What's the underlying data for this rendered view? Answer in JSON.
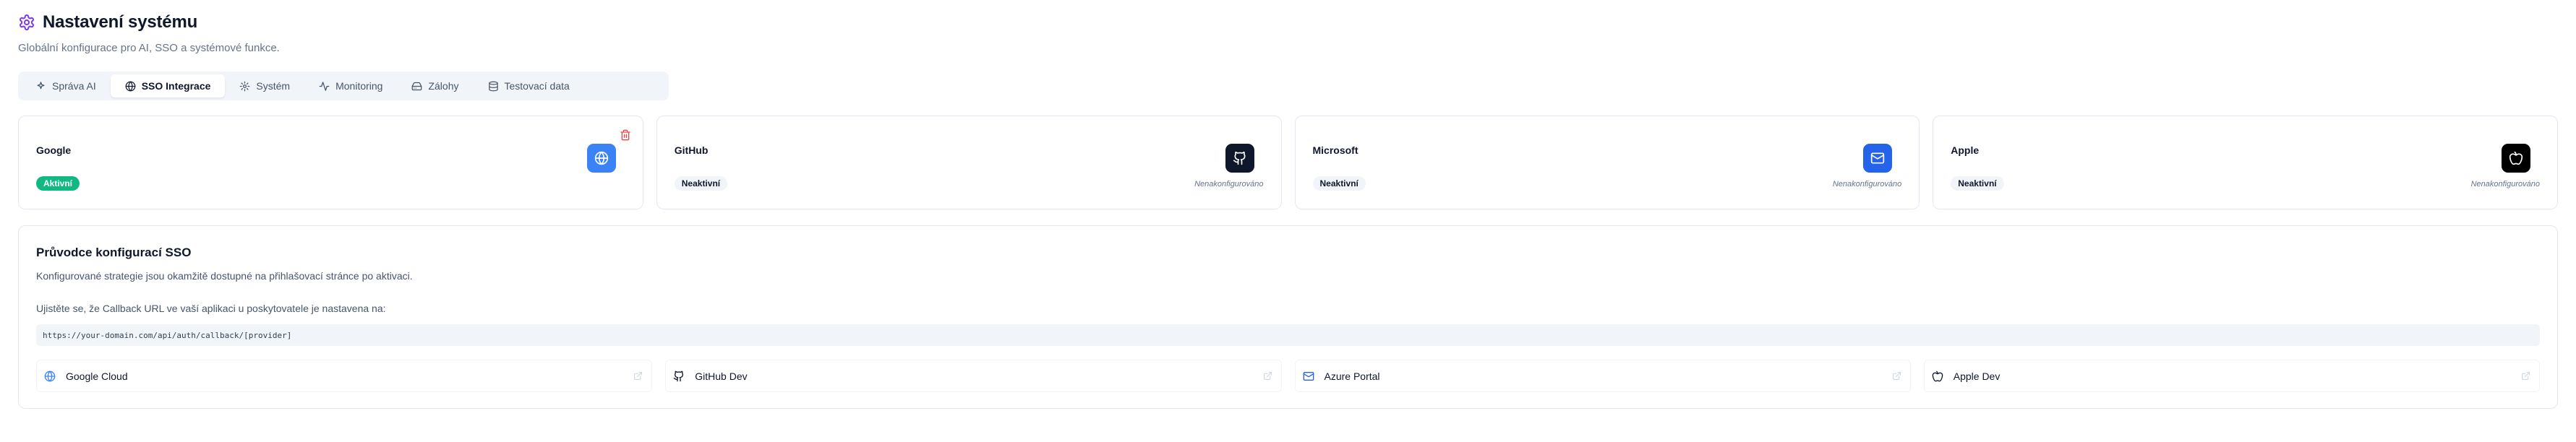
{
  "header": {
    "title": "Nastavení systému",
    "subtitle": "Globální konfigurace pro AI, SSO a systémové funkce.",
    "icon": "gear-icon"
  },
  "tabs": [
    {
      "label": "Správa AI",
      "icon": "sparkles-icon",
      "active": false
    },
    {
      "label": "SSO Integrace",
      "icon": "globe-icon",
      "active": true
    },
    {
      "label": "Systém",
      "icon": "gear-icon",
      "active": false
    },
    {
      "label": "Monitoring",
      "icon": "activity-icon",
      "active": false
    },
    {
      "label": "Zálohy",
      "icon": "drive-icon",
      "active": false
    },
    {
      "label": "Testovací data",
      "icon": "database-icon",
      "active": false
    }
  ],
  "providers": [
    {
      "name": "Google",
      "status": "Aktivní",
      "icon": "globe-icon",
      "icon_bg": "#3b82f6",
      "note": ""
    },
    {
      "name": "GitHub",
      "status": "Neaktivní",
      "icon": "github-icon",
      "icon_bg": "#0f172a",
      "note": "Nenakonfigurováno"
    },
    {
      "name": "Microsoft",
      "status": "Neaktivní",
      "icon": "mail-icon",
      "icon_bg": "#2563eb",
      "note": "Nenakonfigurováno"
    },
    {
      "name": "Apple",
      "status": "Neaktivní",
      "icon": "apple-icon",
      "icon_bg": "#000000",
      "note": "Nenakonfigurováno"
    }
  ],
  "guide": {
    "title": "Průvodce konfigurací SSO",
    "description": "Konfigurované strategie jsou okamžitě dostupné na přihlašovací stránce po aktivaci.",
    "note": "Ujistěte se, že Callback URL ve vaší aplikaci u poskytovatele je nastavena na:",
    "callback_url": "https://your-domain.com/api/auth/callback/[provider]",
    "links": [
      {
        "label": "Google Cloud",
        "icon": "globe-icon"
      },
      {
        "label": "GitHub Dev",
        "icon": "github-icon"
      },
      {
        "label": "Azure Portal",
        "icon": "mail-icon"
      },
      {
        "label": "Apple Dev",
        "icon": "apple-icon"
      }
    ]
  },
  "colors": {
    "accent": "#7c3aed",
    "active_badge": "#10b981",
    "danger": "#ef4444"
  }
}
